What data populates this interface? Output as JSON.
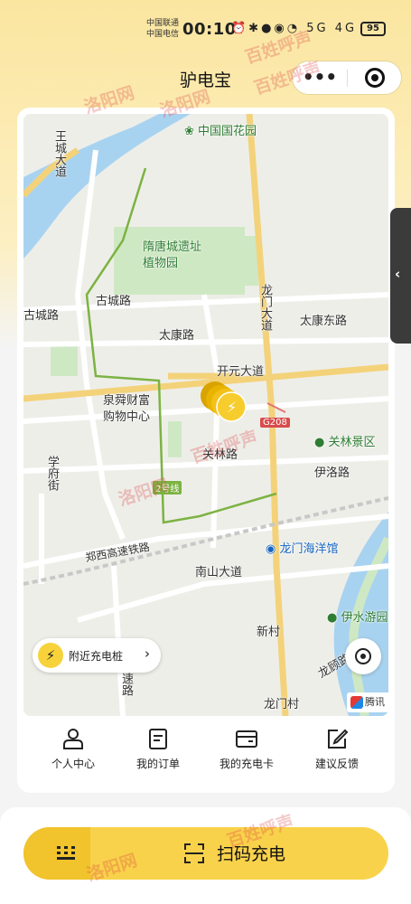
{
  "status_bar": {
    "carrier_1": "中国联通",
    "carrier_2": "中国电信",
    "time": "00:10",
    "icons": "⏰✱●◉◔ 5G 4G",
    "battery": "95"
  },
  "nav": {
    "title": "驴电宝",
    "more_icon": "more-dots-icon",
    "target_icon": "target-icon"
  },
  "map": {
    "labels": {
      "flower_garden": "中国国花园",
      "wangcheng_avenue": "王城大道",
      "suitang_park_1": "隋唐城遗址",
      "suitang_park_2": "植物园",
      "gucheng_road_a": "古城路",
      "gucheng_road_b": "古城路",
      "longmen_avenue": "龙门大道",
      "taikang_road": "太康路",
      "taikang_east_road": "太康东路",
      "kaiyuan_avenue": "开元大道",
      "quanshun_mall_1": "泉舜财富",
      "quanshun_mall_2": "购物中心",
      "g208": "G208",
      "guanlin_scenic": "关林景区",
      "guanlin_road": "关林路",
      "xuefu_street": "学府街",
      "yiluo_road": "伊洛路",
      "line2": "2号线",
      "zhengxi_railway": "郑西高速铁路",
      "ocean_park": "龙门海洋馆",
      "nanshan_avenue": "南山大道",
      "yishui_park": "伊水游园",
      "xincun": "新村",
      "longmen_village": "龙门村",
      "longxiang_road": "龙顾路",
      "suqian_road": "速路"
    },
    "nearby_button": "附近充电桩",
    "map_provider": "腾讯"
  },
  "menu": {
    "items": [
      {
        "label": "个人中心",
        "icon": "person-icon"
      },
      {
        "label": "我的订单",
        "icon": "order-icon"
      },
      {
        "label": "我的充电卡",
        "icon": "card-icon"
      },
      {
        "label": "建议反馈",
        "icon": "edit-icon"
      }
    ]
  },
  "bottom": {
    "scan_label": "扫码充电"
  },
  "watermarks": [
    "洛阳网",
    "百姓呼声",
    "洛阳网",
    "百姓呼声",
    "洛阳网",
    "百姓呼声",
    "洛阳网",
    "百姓呼声"
  ],
  "colors": {
    "accent_yellow": "#f9d24b",
    "header_bg": "#fbe6a0"
  }
}
